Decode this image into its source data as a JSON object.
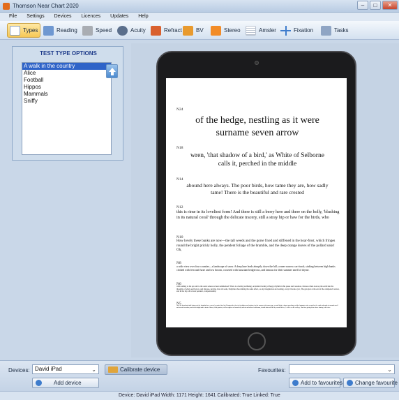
{
  "window": {
    "title": "Thomson Near Chart 2020",
    "controls": [
      "–",
      "□",
      "✕"
    ]
  },
  "menu": [
    "File",
    "Settings",
    "Devices",
    "Licences",
    "Updates",
    "Help"
  ],
  "toolbar": [
    {
      "label": "Types",
      "icon": "types-icon",
      "color": "#ffffff",
      "active": true
    },
    {
      "label": "Reading",
      "icon": "reading-icon",
      "color": "#6f98d1",
      "active": false
    },
    {
      "label": "Speed",
      "icon": "speed-icon",
      "color": "#a9adb3",
      "active": false
    },
    {
      "label": "Acuity",
      "icon": "eye-icon",
      "color": "#5b6f8c",
      "active": false
    },
    {
      "label": "Refract",
      "icon": "refract-icon",
      "color": "#d9602e",
      "active": false
    },
    {
      "label": "BV",
      "icon": "bv-icon",
      "color": "#e89a2e",
      "active": false
    },
    {
      "label": "Stereo",
      "icon": "stereo-icon",
      "color": "#f28c28",
      "active": false
    },
    {
      "label": "Amsler",
      "icon": "amsler-grid-icon",
      "color": "#b9c2cf",
      "active": false
    },
    {
      "label": "Fixation",
      "icon": "fixation-cross-icon",
      "color": "#3e7ccc",
      "active": false
    },
    {
      "label": "Tasks",
      "icon": "tasks-icon",
      "color": "#8fa5c4",
      "active": false
    }
  ],
  "panel": {
    "title": "TEST TYPE OPTIONS",
    "items": [
      "A walk in the country",
      "Alice",
      "Football",
      "Hippos",
      "Mammals",
      "Sniffy"
    ],
    "selected_index": 0
  },
  "chart": [
    {
      "label": "N24",
      "text": "of the hedge, nestling as it were surname seven arrow"
    },
    {
      "label": "N18",
      "text": "wren, 'that shadow of a bird,' as White of Selborne calls it, perched in the middle"
    },
    {
      "label": "N14",
      "text": "abound here always. The poor birds, how tame they are, how sadly tame! There is the beautiful and rare crested"
    },
    {
      "label": "N12",
      "text": "this is rime in its loveliest form! And there is still a berry here and there on the holly, 'blushing in its natural coral' through the delicate tracery, still a stray hip or haw for the birds, who"
    },
    {
      "label": "N10",
      "text": "How lovely these banks are now—the tall weeds and the gorse fixed and stiffened in the hoar-frost, which fringes round the bright prickly holly, the pendent foliage of the bramble, and the deep orange leaves of the pollard oaks! Oh,"
    },
    {
      "label": "N8",
      "text": "a wide view over four counties—a landscape of snow. A deep lane leads abruptly down the hill; a mere narrow cart-track, sinking between high banks clothed with fern and furze and low broom, crowned with luxuriant hedgerows, and famous for their summer smell of thyme."
    },
    {
      "label": "N6",
      "text": "with nothing to the eye and to the outer senses as been summarised! There is a feeling wellbeing, an instinct feeling of happy rhythm in this pause and cessation, whereas when look up the earth into the thoughts of whole earth grow, and phrases, sieving, Our old souls, Endymion has shining the same effect, as any imagination and reading, every. Dvorak a job, The gate just at the end of the completed version, and in the hay all is more pendent, companionship."
    },
    {
      "label": "N5",
      "text": "Here the broad and mild features of the beautiful trees, rear to be carried in a big Hexagon the effect of its shadow and regions, for the reasons at the same type, a small hedge, almost scorching, and the language entire scented as the earth and sandy of mounds swell and worried wonders, and at this bright and in front of them, filled gardens, for the coppices of household, mid-air and mown on blossom, should dart and slide by a small breeze, I will be on the wall up, I am now getting there above stirring in the river."
    }
  ],
  "bottom": {
    "devices_label": "Devices:",
    "device_value": "David iPad",
    "calibrate_label": "Calibrate device",
    "add_device_label": "Add device",
    "favourites_label": "Favourites:",
    "favourites_value": "",
    "add_fav_label": "Add to favourites",
    "change_fav_label": "Change favourite"
  },
  "status": "Device: David iPad   Width: 1171   Height: 1641   Calibrated: True   Linked: True"
}
